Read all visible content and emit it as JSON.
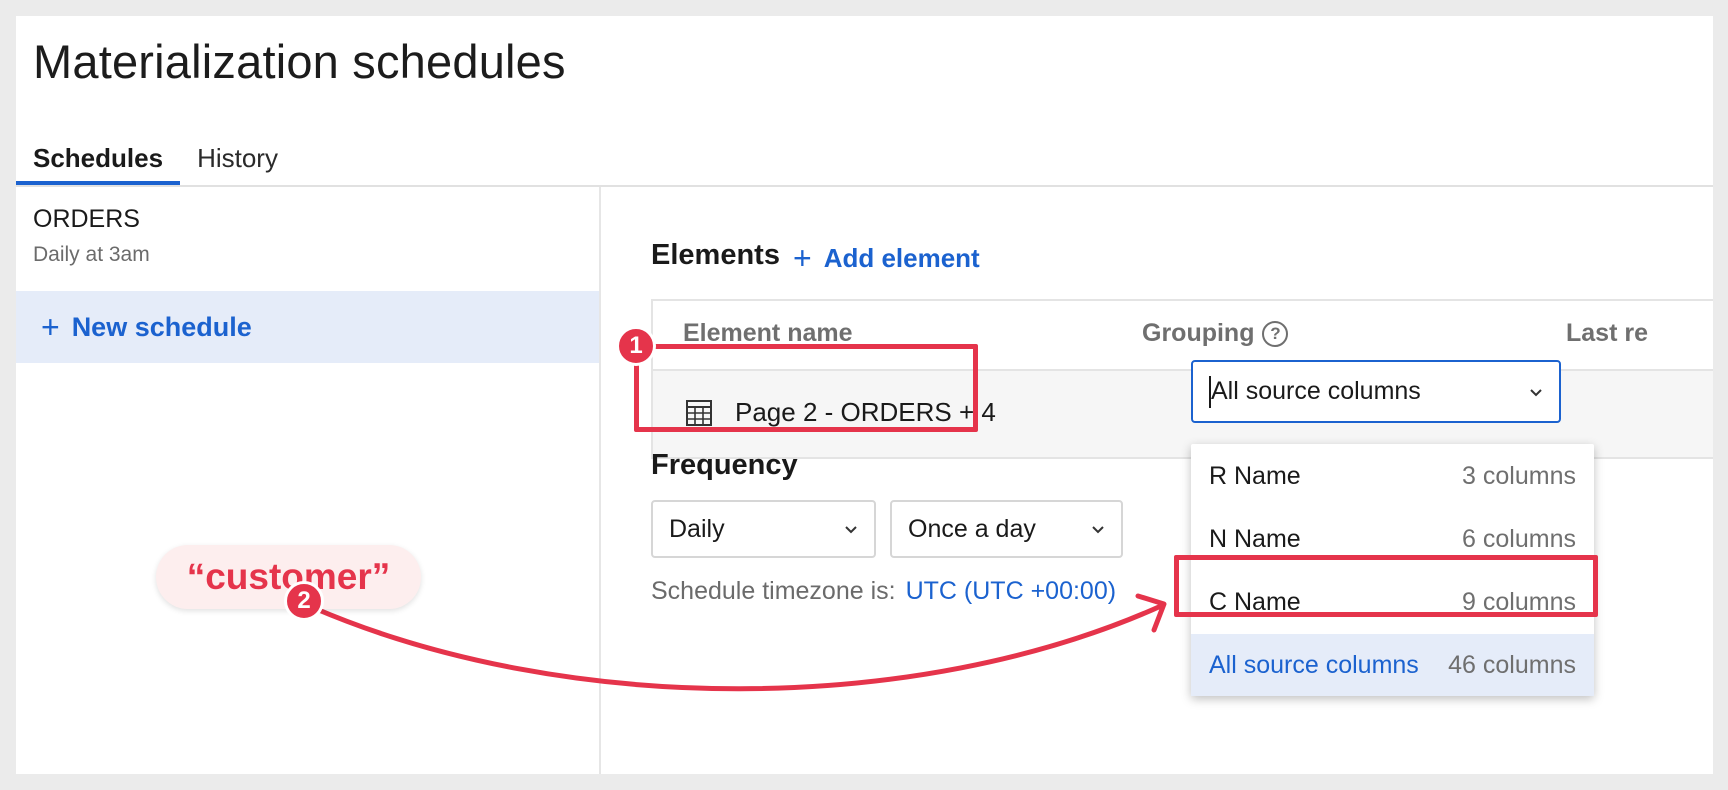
{
  "page_title": "Materialization schedules",
  "tabs": [
    {
      "label": "Schedules",
      "active": true
    },
    {
      "label": "History",
      "active": false
    }
  ],
  "sidebar": {
    "schedule_name": "ORDERS",
    "schedule_sub": "Daily at 3am",
    "new_schedule": "New schedule"
  },
  "elements": {
    "heading": "Elements",
    "add_label": "Add element",
    "columns": [
      "Element name",
      "Grouping",
      "Last re"
    ],
    "row_name": "Page 2 - ORDERS + 4",
    "grouping_value": "All source columns"
  },
  "frequency": {
    "heading": "Frequency",
    "period": "Daily",
    "times": "Once a day",
    "tz_label": "Schedule timezone is:",
    "tz_value": "UTC (UTC +00:00)"
  },
  "dropdown": {
    "options": [
      {
        "name": "R Name",
        "count": "3 columns"
      },
      {
        "name": "N Name",
        "count": "6 columns"
      },
      {
        "name": "C Name",
        "count": "9 columns"
      },
      {
        "name": "All source columns",
        "count": "46 columns"
      }
    ],
    "selected_index": 3
  },
  "annotations": {
    "badge1": "1",
    "badge2": "2",
    "callout": "“customer”"
  },
  "colors": {
    "accent": "#1b62cf",
    "highlight": "#e5344b"
  }
}
